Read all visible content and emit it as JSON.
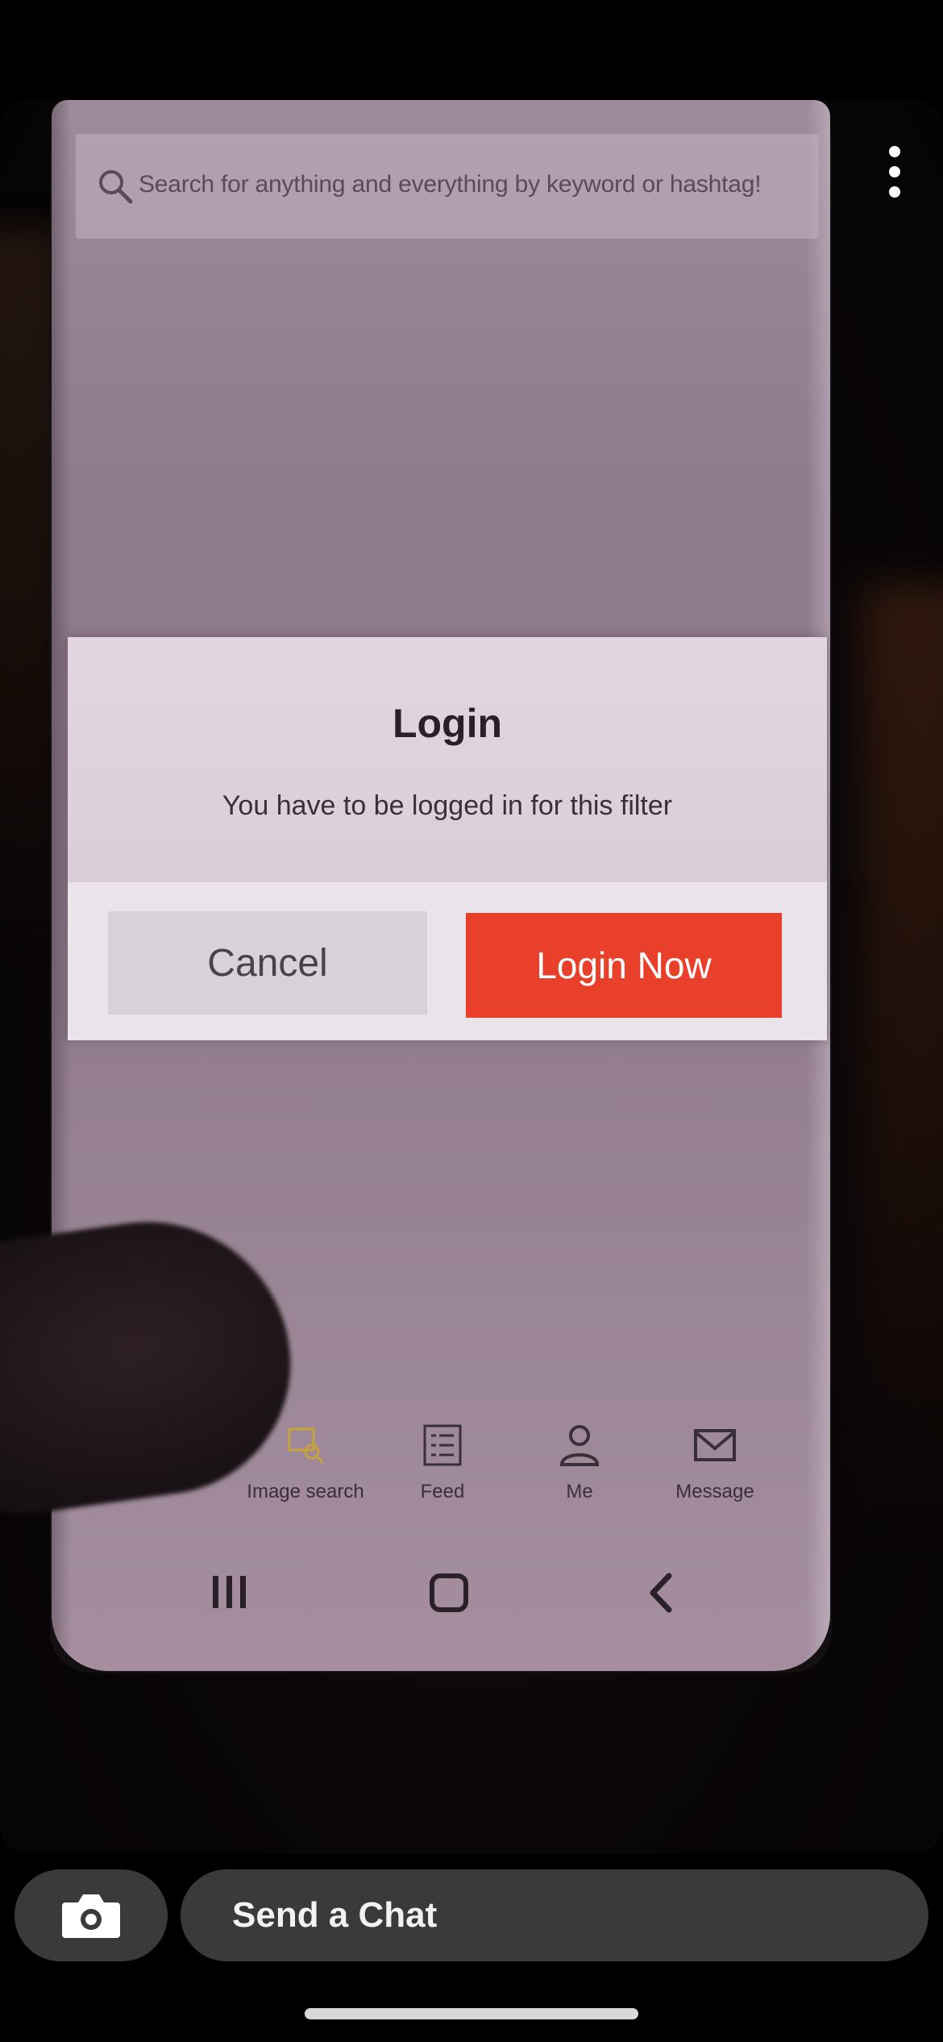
{
  "story": {
    "search": {
      "placeholder": "Search for anything and everything by keyword or hashtag!"
    },
    "dialog": {
      "title": "Login",
      "message": "You have to be logged in for this filter",
      "cancel_label": "Cancel",
      "login_label": "Login Now",
      "login_color": "#e8402a"
    },
    "bottom_nav": [
      {
        "label": "Image search",
        "icon": "image-search-icon"
      },
      {
        "label": "Feed",
        "icon": "feed-icon"
      },
      {
        "label": "Me",
        "icon": "person-icon"
      },
      {
        "label": "Message",
        "icon": "mail-icon"
      }
    ]
  },
  "snap_ui": {
    "chat_placeholder": "Send a Chat",
    "camera_icon": "camera-icon",
    "more_icon": "more-vertical-icon"
  }
}
